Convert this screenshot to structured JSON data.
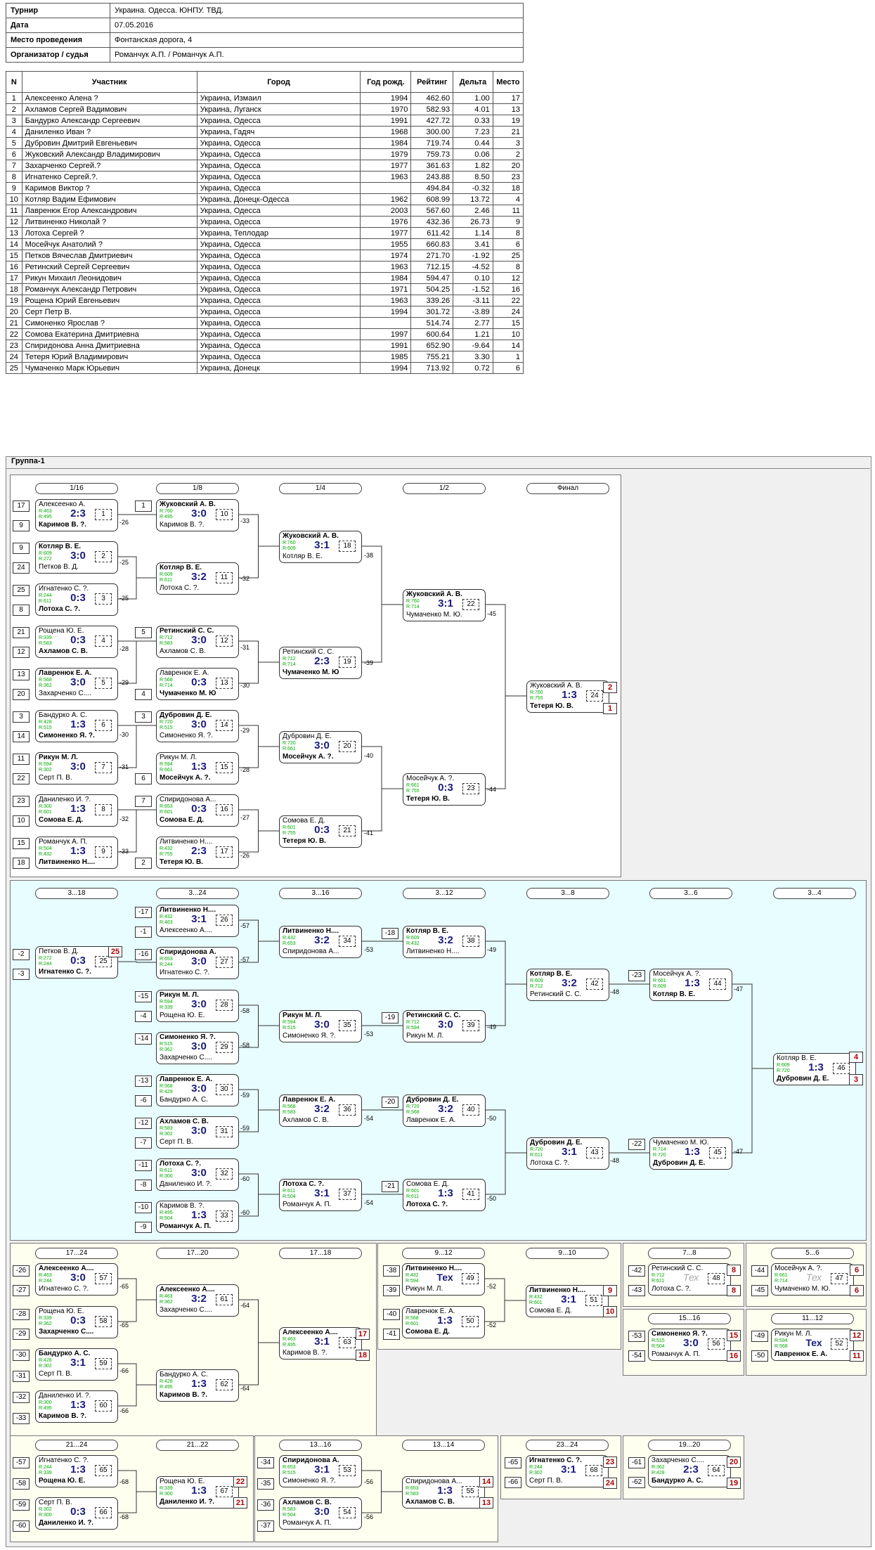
{
  "tournament": {
    "labels": {
      "tournament": "Турнир",
      "date": "Дата",
      "place": "Место проведения",
      "organizer": "Организатор / судья"
    },
    "values": {
      "tournament": "Украина. Одесса. ЮНПУ. ТВД.",
      "date": "07.05.2016",
      "place": "Фонтанская дорога, 4",
      "organizer": "Романчук А.П. /  Романчук А.П."
    }
  },
  "participants": {
    "headers": [
      "N",
      "Участник",
      "Город",
      "Год рожд.",
      "Рейтинг",
      "Дельта",
      "Место"
    ],
    "rows": [
      [
        "1",
        "Алексеенко Алена ?",
        "Украина, Измаил",
        "1994",
        "462.60",
        "1.00",
        "17"
      ],
      [
        "2",
        "Ахламов Сергей Вадимович",
        "Украина, Луганск",
        "1970",
        "582.93",
        "4.01",
        "13"
      ],
      [
        "3",
        "Бандурко Александр Сергеевич",
        "Украина, Одесса",
        "1991",
        "427.72",
        "0.33",
        "19"
      ],
      [
        "4",
        "Даниленко Иван ?",
        "Украина, Гадяч",
        "1968",
        "300.00",
        "7.23",
        "21"
      ],
      [
        "5",
        "Дубровин Дмитрий Евгеньевич",
        "Украина, Одесса",
        "1984",
        "719.74",
        "0.44",
        "3"
      ],
      [
        "6",
        "Жуковский Александр Владимирович",
        "Украина, Одесса",
        "1979",
        "759.73",
        "0.06",
        "2"
      ],
      [
        "7",
        "Захарченко Сергей.?",
        "Украина, Одесса",
        "1977",
        "361.63",
        "1.82",
        "20"
      ],
      [
        "8",
        "Игнатенко Сергей.?.",
        "Украина, Одесса",
        "1963",
        "243.88",
        "8.50",
        "23"
      ],
      [
        "9",
        "Каримов Виктор ?",
        "Украина, Одесса",
        "",
        "494.84",
        "-0.32",
        "18"
      ],
      [
        "10",
        "Котляр Вадим Ефимович",
        "Украина, Донецк-Одесса",
        "1962",
        "608.99",
        "13.72",
        "4"
      ],
      [
        "11",
        "Лавренюк Егор Александрович",
        "Украина, Одесса",
        "2003",
        "567.60",
        "2.46",
        "11"
      ],
      [
        "12",
        "Литвиненко Николай ?",
        "Украина, Одесса",
        "1976",
        "432.36",
        "26.73",
        "9"
      ],
      [
        "13",
        "Лотоха Сергей ?",
        "Украина, Теплодар",
        "1977",
        "611.42",
        "1.14",
        "8"
      ],
      [
        "14",
        "Мосейчук Анатолий ?",
        "Украина, Одесса",
        "1955",
        "660.83",
        "3.41",
        "6"
      ],
      [
        "15",
        "Петков Вячеслав Дмитриевич",
        "Украина, Одесса",
        "1974",
        "271.70",
        "-1.92",
        "25"
      ],
      [
        "16",
        "Ретинский Сергей Сергеевич",
        "Украина, Одесса",
        "1963",
        "712.15",
        "-4.52",
        "8"
      ],
      [
        "17",
        "Рикун Михаил Леонидович",
        "Украина, Одесса",
        "1984",
        "594.47",
        "0.10",
        "12"
      ],
      [
        "18",
        "Романчук Александр Петрович",
        "Украина, Одесса",
        "1971",
        "504.25",
        "-1.52",
        "16"
      ],
      [
        "19",
        "Рощена Юрий Евгеньевич",
        "Украина, Одесса",
        "1963",
        "339.26",
        "-3.11",
        "22"
      ],
      [
        "20",
        "Серт Петр В.",
        "Украина, Одесса",
        "1994",
        "301.72",
        "-3.89",
        "24"
      ],
      [
        "21",
        "Симоненко Ярослав ?",
        "Украина, Одесса",
        "",
        "514.74",
        "2.77",
        "15"
      ],
      [
        "22",
        "Сомова Екатерина Дмитриевна",
        "Украина, Одесса",
        "1997",
        "600.64",
        "1.21",
        "10"
      ],
      [
        "23",
        "Спиридонова Анна Дмитриевна",
        "Украина, Одесса",
        "1991",
        "652.90",
        "-9.64",
        "14"
      ],
      [
        "24",
        "Тетеря Юрий Владимирович",
        "Украина, Одесса",
        "1985",
        "755.21",
        "3.30",
        "1"
      ],
      [
        "25",
        "Чумаченко Марк Юрьевич",
        "Украина, Донецк",
        "1994",
        "713.92",
        "0.72",
        "6"
      ]
    ]
  },
  "group": {
    "title": "Группа-1",
    "rounds": [
      "1/16",
      "1/8",
      "1/4",
      "1/2",
      "Финал",
      "3...18",
      "3...24",
      "3...16",
      "3...12",
      "3...8",
      "3...6",
      "3...4",
      "17...24",
      "17...20",
      "17...18",
      "9...12",
      "9...10",
      "7...8",
      "5...6",
      "15...16",
      "11...12",
      "21...24",
      "21...22",
      "13...16",
      "13...14",
      "23...24",
      "19...20"
    ],
    "matches": [
      {
        "p1": "Алексеенко А.",
        "r1": "R:463",
        "p2": "Каримов В. ?.",
        "r2": "R:495",
        "score": "2:3",
        "num": "1",
        "winner": 2
      },
      {
        "p1": "Котляр В. Е.",
        "r1": "R:609",
        "p2": "Петков В. Д.",
        "r2": "R:272",
        "score": "3:0",
        "num": "2",
        "winner": 1
      },
      {
        "p1": "Игнатенко С. ?.",
        "r1": "R:244",
        "p2": "Лотоха С. ?.",
        "r2": "R:611",
        "score": "0:3",
        "num": "3",
        "winner": 2
      },
      {
        "p1": "Рощена Ю. Е.",
        "r1": "R:339",
        "p2": "Ахламов С. В.",
        "r2": "R:583",
        "score": "0:3",
        "num": "4",
        "winner": 2
      },
      {
        "p1": "Лавренюк Е. А.",
        "r1": "R:568",
        "p2": "Захарченко С....",
        "r2": "R:362",
        "score": "3:0",
        "num": "5",
        "winner": 1
      },
      {
        "p1": "Бандурко А. С.",
        "r1": "R:428",
        "p2": "Симоненко Я. ?.",
        "r2": "R:515",
        "score": "1:3",
        "num": "6",
        "winner": 2
      },
      {
        "p1": "Рикун М. Л.",
        "r1": "R:594",
        "p2": "Серт П. В.",
        "r2": "R:302",
        "score": "3:0",
        "num": "7",
        "winner": 1
      },
      {
        "p1": "Даниленко И. ?.",
        "r1": "R:300",
        "p2": "Сомова Е. Д.",
        "r2": "R:601",
        "score": "1:3",
        "num": "8",
        "winner": 2
      },
      {
        "p1": "Романчук А. П.",
        "r1": "R:504",
        "p2": "Литвиненко Н....",
        "r2": "R:432",
        "score": "1:3",
        "num": "9",
        "winner": 2
      },
      {
        "p1": "Жуковский А. В.",
        "r1": "R:760",
        "p2": "Каримов В. ?.",
        "r2": "R:495",
        "score": "3:0",
        "num": "10",
        "winner": 1
      },
      {
        "p1": "Котляр В. Е.",
        "r1": "R:609",
        "p2": "Лотоха С. ?.",
        "r2": "R:611",
        "score": "3:2",
        "num": "11",
        "winner": 1
      },
      {
        "p1": "Ретинский С. С.",
        "r1": "R:712",
        "p2": "Ахламов С. В.",
        "r2": "R:583",
        "score": "3:0",
        "num": "12",
        "winner": 1
      },
      {
        "p1": "Лавренюк Е. А.",
        "r1": "R:568",
        "p2": "Чумаченко М. Ю.",
        "r2": "R:714",
        "score": "0:3",
        "num": "13",
        "winner": 2
      },
      {
        "p1": "Дубровин Д. Е.",
        "r1": "R:720",
        "p2": "Симоненко Я. ?.",
        "r2": "R:515",
        "score": "3:0",
        "num": "14",
        "winner": 1
      },
      {
        "p1": "Рикун М. Л.",
        "r1": "R:594",
        "p2": "Мосейчук А. ?.",
        "r2": "R:661",
        "score": "1:3",
        "num": "15",
        "winner": 2
      },
      {
        "p1": "Спиридонова А...",
        "r1": "R:653",
        "p2": "Сомова Е. Д.",
        "r2": "R:601",
        "score": "0:3",
        "num": "16",
        "winner": 2
      },
      {
        "p1": "Литвиненко Н....",
        "r1": "R:432",
        "p2": "Тетеря Ю. В.",
        "r2": "R:755",
        "score": "2:3",
        "num": "17",
        "winner": 2
      },
      {
        "p1": "Жуковский А. В.",
        "r1": "R:760",
        "p2": "Котляр В. Е.",
        "r2": "R:609",
        "score": "3:1",
        "num": "18",
        "winner": 1
      },
      {
        "p1": "Ретинский С. С.",
        "r1": "R:712",
        "p2": "Чумаченко М. Ю.",
        "r2": "R:714",
        "score": "2:3",
        "num": "19",
        "winner": 2
      },
      {
        "p1": "Дубровин Д. Е.",
        "r1": "R:720",
        "p2": "Мосейчук А. ?.",
        "r2": "R:661",
        "score": "3:0",
        "num": "20",
        "winner": 2
      },
      {
        "p1": "Сомова Е. Д.",
        "r1": "R:601",
        "p2": "Тетеря Ю. В.",
        "r2": "R:755",
        "score": "0:3",
        "num": "21",
        "winner": 2
      },
      {
        "p1": "Жуковский А. В.",
        "r1": "R:760",
        "p2": "Чумаченко М. Ю.",
        "r2": "R:714",
        "score": "3:1",
        "num": "22",
        "winner": 1
      },
      {
        "p1": "Мосейчук А. ?.",
        "r1": "R:661",
        "p2": "Тетеря Ю. В.",
        "r2": "R:755",
        "score": "0:3",
        "num": "23",
        "winner": 2
      },
      {
        "p1": "Жуковский А. В.",
        "r1": "R:760",
        "p2": "Тетеря Ю. В.",
        "r2": "R:755",
        "score": "1:3",
        "num": "24",
        "winner": 2
      },
      {
        "p1": "Петков В. Д.",
        "r1": "R:272",
        "p2": "Игнатенко С. ?.",
        "r2": "R:244",
        "score": "0:3",
        "num": "25",
        "winner": 2
      },
      {
        "p1": "Литвиненко Н....",
        "r1": "R:432",
        "p2": "Алексеенко А....",
        "r2": "R:463",
        "score": "3:1",
        "num": "26",
        "winner": 1
      },
      {
        "p1": "Спиридонова А...",
        "r1": "R:653",
        "p2": "Игнатенко С. ?.",
        "r2": "R:244",
        "score": "3:0",
        "num": "27",
        "winner": 1
      },
      {
        "p1": "Рикун М. Л.",
        "r1": "R:594",
        "p2": "Рощена Ю. Е.",
        "r2": "R:339",
        "score": "3:0",
        "num": "28",
        "winner": 1
      },
      {
        "p1": "Симоненко Я. ?.",
        "r1": "R:515",
        "p2": "Захарченко С....",
        "r2": "R:362",
        "score": "3:0",
        "num": "29",
        "winner": 1
      },
      {
        "p1": "Лавренюк Е. А.",
        "r1": "R:568",
        "p2": "Бандурко А. С.",
        "r2": "R:429",
        "score": "3:0",
        "num": "30",
        "winner": 1
      },
      {
        "p1": "Ахламов С. В.",
        "r1": "R:583",
        "p2": "Серт П. В.",
        "r2": "R:302",
        "score": "3:0",
        "num": "31",
        "winner": 1
      },
      {
        "p1": "Лотоха С. ?.",
        "r1": "R:611",
        "p2": "Даниленко И. ?.",
        "r2": "R:300",
        "score": "3:0",
        "num": "32",
        "winner": 1
      },
      {
        "p1": "Каримов В. ?.",
        "r1": "R:495",
        "p2": "Романчук А. П.",
        "r2": "R:504",
        "score": "1:3",
        "num": "33",
        "winner": 2
      },
      {
        "p1": "Литвиненко Н....",
        "r1": "R:432",
        "p2": "Спиридонова А...",
        "r2": "R:653",
        "score": "3:2",
        "num": "34",
        "winner": 1
      },
      {
        "p1": "Рикун М. Л.",
        "r1": "R:594",
        "p2": "Симоненко Я. ?.",
        "r2": "R:515",
        "score": "3:0",
        "num": "35",
        "winner": 1
      },
      {
        "p1": "Лавренюк Е. А.",
        "r1": "R:568",
        "p2": "Ахламов С. В.",
        "r2": "R:583",
        "score": "3:2",
        "num": "36",
        "winner": 1
      },
      {
        "p1": "Лотоха С. ?.",
        "r1": "R:611",
        "p2": "Романчук А. П.",
        "r2": "R:504",
        "score": "3:1",
        "num": "37",
        "winner": 1
      },
      {
        "p1": "Котляр В. Е.",
        "r1": "R:609",
        "p2": "Литвиненко Н....",
        "r2": "R:432",
        "score": "3:2",
        "num": "38",
        "winner": 1
      },
      {
        "p1": "Ретинский С. С.",
        "r1": "R:712",
        "p2": "Рикун М. Л.",
        "r2": "R:594",
        "score": "3:0",
        "num": "39",
        "winner": 1
      },
      {
        "p1": "Дубровин Д. Е.",
        "r1": "R:720",
        "p2": "Лавренюк Е. А.",
        "r2": "R:568",
        "score": "3:2",
        "num": "40",
        "winner": 1
      },
      {
        "p1": "Сомова Е. Д.",
        "r1": "R:601",
        "p2": "Лотоха С. ?.",
        "r2": "R:611",
        "score": "1:3",
        "num": "41",
        "winner": 2
      },
      {
        "p1": "Котляр В. Е.",
        "r1": "R:609",
        "p2": "Ретинский С. С.",
        "r2": "R:712",
        "score": "3:2",
        "num": "42",
        "winner": 1
      },
      {
        "p1": "Дубровин Д. Е.",
        "r1": "R:720",
        "p2": "Лотоха С. ?.",
        "r2": "R:611",
        "score": "3:1",
        "num": "43",
        "winner": 1
      },
      {
        "p1": "Мосейчук А. ?.",
        "r1": "R:661",
        "p2": "Котляр В. Е.",
        "r2": "R:609",
        "score": "1:3",
        "num": "44",
        "winner": 2
      },
      {
        "p1": "Чумаченко М. Ю.",
        "r1": "R:714",
        "p2": "Дубровин Д. Е.",
        "r2": "R:720",
        "score": "1:3",
        "num": "45",
        "winner": 2
      },
      {
        "p1": "Котляр В. Е.",
        "r1": "R:609",
        "p2": "Дубровин Д. Е.",
        "r2": "R:720",
        "score": "1:3",
        "num": "46",
        "winner": 2
      },
      {
        "p1": "Мосейчук А. ?.",
        "r1": "R:661",
        "p2": "Чумаченко М. Ю.",
        "r2": "R:714",
        "score": "Тех",
        "num": "47",
        "winner": 0
      },
      {
        "p1": "Ретинский С. С.",
        "r1": "R:712",
        "p2": "Лотоха С. ?.",
        "r2": "R:611",
        "score": "Тех",
        "num": "48",
        "winner": 0
      },
      {
        "p1": "Литвиненко Н....",
        "r1": "R:432",
        "p2": "Рикун М. Л.",
        "r2": "R:594",
        "score": "Тех",
        "num": "49",
        "winner": 1
      },
      {
        "p1": "Лавренюк Е. А.",
        "r1": "R:568",
        "p2": "Сомова Е. Д.",
        "r2": "R:601",
        "score": "1:3",
        "num": "50",
        "winner": 2
      },
      {
        "p1": "Литвиненко Н....",
        "r1": "R:432",
        "p2": "Сомова Е. Д.",
        "r2": "R:601",
        "score": "3:1",
        "num": "51",
        "winner": 1
      },
      {
        "p1": "Рикун М. Л.",
        "r1": "R:594",
        "p2": "Лавренюк Е. А.",
        "r2": "R:568",
        "score": "Тех",
        "num": "52",
        "winner": 2
      },
      {
        "p1": "Спиридонова А...",
        "r1": "R:653",
        "p2": "Симоненко Я. ?.",
        "r2": "R:515",
        "score": "3:1",
        "num": "53",
        "winner": 1
      },
      {
        "p1": "Ахламов С. В.",
        "r1": "R:583",
        "p2": "Романчук А. П.",
        "r2": "R:504",
        "score": "3:0",
        "num": "54",
        "winner": 1
      },
      {
        "p1": "Спиридонова А...",
        "r1": "R:653",
        "p2": "Ахламов С. В.",
        "r2": "R:583",
        "score": "1:3",
        "num": "55",
        "winner": 2
      },
      {
        "p1": "Симоненко Я. ?.",
        "r1": "R:515",
        "p2": "Романчук А. П.",
        "r2": "R:504",
        "score": "3:0",
        "num": "56",
        "winner": 1
      },
      {
        "p1": "Алексеенко А....",
        "r1": "R:463",
        "p2": "Игнатенко С. ?.",
        "r2": "R:244",
        "score": "3:0",
        "num": "57",
        "winner": 1
      },
      {
        "p1": "Рощена Ю. Е.",
        "r1": "R:339",
        "p2": "Захарченко С....",
        "r2": "R:362",
        "score": "0:3",
        "num": "58",
        "winner": 2
      },
      {
        "p1": "Бандурко А. С.",
        "r1": "R:428",
        "p2": "Серт П. В.",
        "r2": "R:302",
        "score": "3:1",
        "num": "59",
        "winner": 1
      },
      {
        "p1": "Даниленко И. ?.",
        "r1": "R:300",
        "p2": "Каримов В. ?.",
        "r2": "R:495",
        "score": "1:3",
        "num": "60",
        "winner": 2
      },
      {
        "p1": "Алексеенко А....",
        "r1": "R:463",
        "p2": "Захарченко С....",
        "r2": "R:362",
        "score": "3:2",
        "num": "61",
        "winner": 1
      },
      {
        "p1": "Бандурко А. С.",
        "r1": "R:428",
        "p2": "Каримов В. ?.",
        "r2": "R:495",
        "score": "1:3",
        "num": "62",
        "winner": 2
      },
      {
        "p1": "Алексеенко А....",
        "r1": "R:463",
        "p2": "Каримов В. ?.",
        "r2": "R:495",
        "score": "3:1",
        "num": "63",
        "winner": 1
      },
      {
        "p1": "Захарченко С....",
        "r1": "R:362",
        "p2": "Бандурко А. С.",
        "r2": "R:428",
        "score": "2:3",
        "num": "64",
        "winner": 2
      },
      {
        "p1": "Игнатенко С. ?.",
        "r1": "R:244",
        "p2": "Рощена Ю. Е.",
        "r2": "R:339",
        "score": "1:3",
        "num": "65",
        "winner": 2
      },
      {
        "p1": "Серт П. В.",
        "r1": "R:302",
        "p2": "Даниленко И. ?.",
        "r2": "R:300",
        "score": "0:3",
        "num": "66",
        "winner": 2
      },
      {
        "p1": "Рощена Ю. Е.",
        "r1": "R:339",
        "p2": "Даниленко И. ?.",
        "r2": "R:300",
        "score": "1:3",
        "num": "67",
        "winner": 2
      },
      {
        "p1": "Игнатенко С. ?.",
        "r1": "R:244",
        "p2": "Серт П. В.",
        "r2": "R:302",
        "score": "3:1",
        "num": "68",
        "winner": 1
      }
    ],
    "places": {
      "f1": "2",
      "f2": "1",
      "g1": "4",
      "g2": "3",
      "h1": "17",
      "h2": "18",
      "i1": "9",
      "i2": "10",
      "j1": "8",
      "j2": "8",
      "k1": "6",
      "k2": "6",
      "l1": "15",
      "l2": "16",
      "m1": "12",
      "m2": "11",
      "n1": "22",
      "n2": "21",
      "o1": "14",
      "o2": "13",
      "q1": "23",
      "q2": "24",
      "s1": "20",
      "s2": "19",
      "p25": "25"
    }
  }
}
